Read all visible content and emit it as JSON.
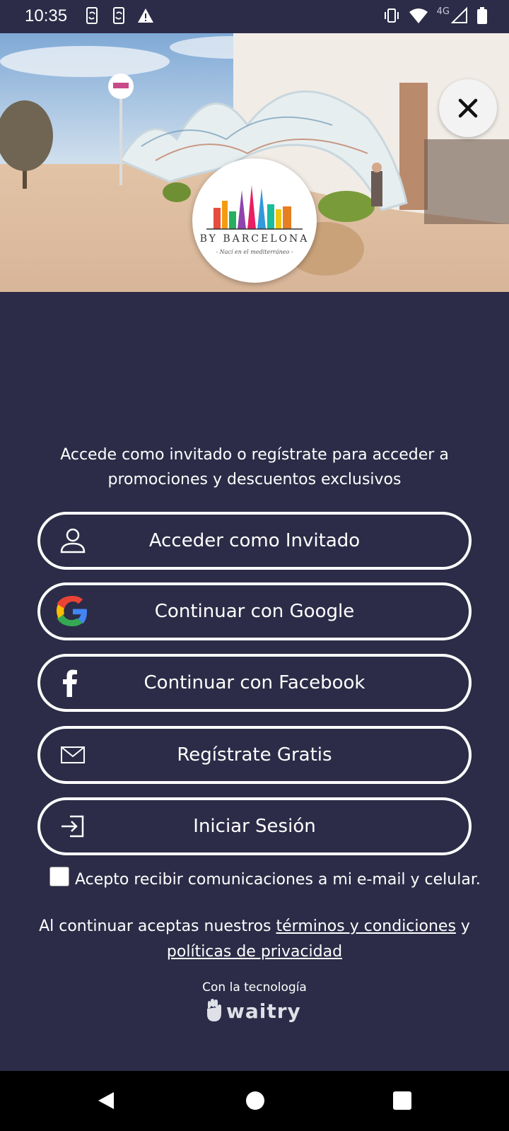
{
  "status_bar": {
    "time": "10:35",
    "network": "4G",
    "left_icons": [
      "phone-sync-icon",
      "phone-sync-icon",
      "warning-icon"
    ],
    "right_icons": [
      "vibrate-icon",
      "wifi-icon",
      "signal-icon",
      "battery-icon"
    ]
  },
  "hero": {
    "logo_title": "BY BARCELONA",
    "logo_subtitle": "- Nací en el mediterráneo -"
  },
  "intro_text": "Accede como invitado o regístrate para acceder a promociones y descuentos exclusivos",
  "buttons": {
    "guest": "Acceder como Invitado",
    "google": "Continuar con Google",
    "facebook": "Continuar con Facebook",
    "register": "Regístrate Gratis",
    "login": "Iniciar Sesión"
  },
  "consent_label": "Acepto recibir comunicaciones a mi e-mail y celular.",
  "legal": {
    "prefix": "Al continuar aceptas nuestros ",
    "terms_link": "términos y condiciones",
    "middle": " y",
    "privacy_link": "políticas de privacidad"
  },
  "powered_by": {
    "label": "Con la tecnología",
    "brand": "waitry"
  },
  "colors": {
    "background": "#2c2c48",
    "text": "#ffffff",
    "nav_bar": "#000000"
  }
}
